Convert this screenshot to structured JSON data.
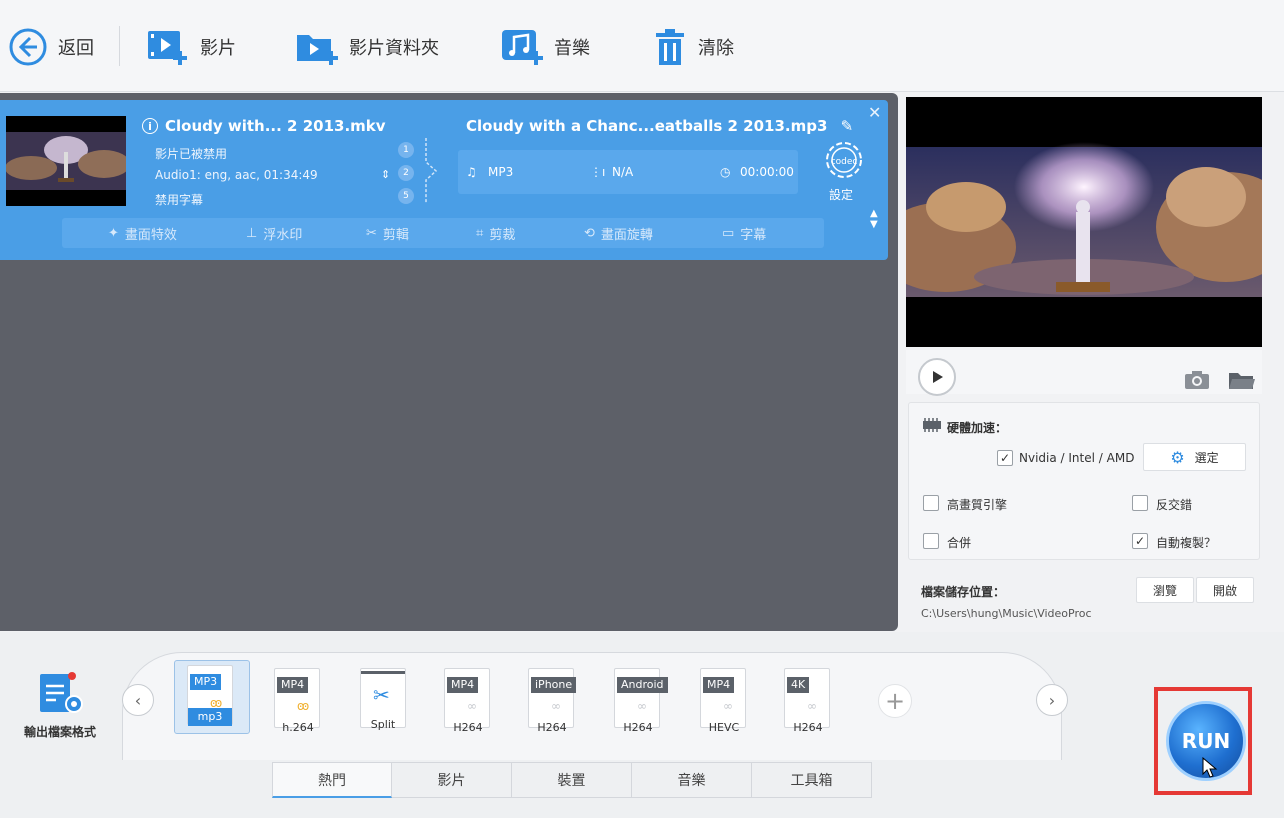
{
  "toolbar": {
    "back": "返回",
    "video": "影片",
    "video_folder": "影片資料夾",
    "music": "音樂",
    "clear": "清除"
  },
  "item": {
    "source_title": "Cloudy with... 2 2013.mkv",
    "source_lines": [
      "影片已被禁用",
      "Audio1: eng, aac, 01:34:49",
      "禁用字幕"
    ],
    "track_badges": [
      "1",
      "2",
      "5"
    ],
    "output_title": "Cloudy with a Chanc...eatballs 2 2013.mp3",
    "output_format": "MP3",
    "output_res": "N/A",
    "output_duration": "00:00:00",
    "codec_label": "設定",
    "edit_buttons": [
      "畫面特效",
      "浮水印",
      "剪輯",
      "剪裁",
      "畫面旋轉",
      "字幕"
    ]
  },
  "options": {
    "hw_accel_label": "硬體加速：",
    "nvidia_label": "Nvidia / Intel / AMD",
    "nvidia_checked": true,
    "settings_button": "選定",
    "high_quality": "高畫質引擎",
    "high_quality_checked": false,
    "deinterlace": "反交錯",
    "deinterlace_checked": false,
    "merge": "合併",
    "merge_checked": false,
    "auto_copy": "自動複製？",
    "auto_copy_checked": true,
    "save_path_label": "檔案儲存位置：",
    "browse_button": "瀏覽",
    "open_button": "開啟",
    "save_path": "C:\\Users\\hung\\Music\\VideoProc"
  },
  "formats": {
    "output_format_label": "輸出檔案格式",
    "items": [
      {
        "tag": "MP3",
        "sub": "mp3",
        "selected": true
      },
      {
        "tag": "MP4",
        "sub": "h.264",
        "selected": false
      },
      {
        "tag": "",
        "sub": "Split",
        "selected": false
      },
      {
        "tag": "MP4",
        "sub": "H264",
        "selected": false
      },
      {
        "tag": "iPhone",
        "sub": "H264",
        "selected": false
      },
      {
        "tag": "Android",
        "sub": "H264",
        "selected": false
      },
      {
        "tag": "MP4",
        "sub": "HEVC",
        "selected": false
      },
      {
        "tag": "4K",
        "sub": "H264",
        "selected": false
      }
    ],
    "add_symbol": "+"
  },
  "tabs": [
    "熱門",
    "影片",
    "裝置",
    "音樂",
    "工具箱"
  ],
  "run_label": "RUN",
  "colors": {
    "accent": "#4a9ee6",
    "run_highlight": "#e53935"
  }
}
